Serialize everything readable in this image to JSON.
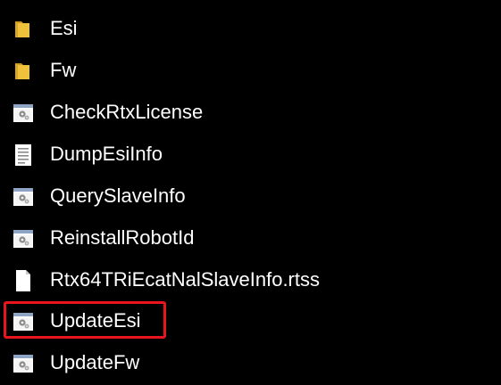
{
  "file_list": {
    "items": [
      {
        "name": "Esi",
        "type": "folder",
        "icon": "folder-icon"
      },
      {
        "name": "Fw",
        "type": "folder",
        "icon": "folder-icon"
      },
      {
        "name": "CheckRtxLicense",
        "type": "application",
        "icon": "application-icon"
      },
      {
        "name": "DumpEsiInfo",
        "type": "text-document",
        "icon": "text-document-icon"
      },
      {
        "name": "QuerySlaveInfo",
        "type": "application",
        "icon": "application-icon"
      },
      {
        "name": "ReinstallRobotId",
        "type": "application",
        "icon": "application-icon"
      },
      {
        "name": "Rtx64TRiEcatNalSlaveInfo.rtss",
        "type": "file",
        "icon": "blank-file-icon"
      },
      {
        "name": "UpdateEsi",
        "type": "application",
        "icon": "application-icon",
        "highlighted": true
      },
      {
        "name": "UpdateFw",
        "type": "application",
        "icon": "application-icon"
      }
    ]
  },
  "colors": {
    "background": "#000000",
    "text": "#ffffff",
    "folder": "#f0c23c",
    "highlight_border": "#e8141e"
  }
}
